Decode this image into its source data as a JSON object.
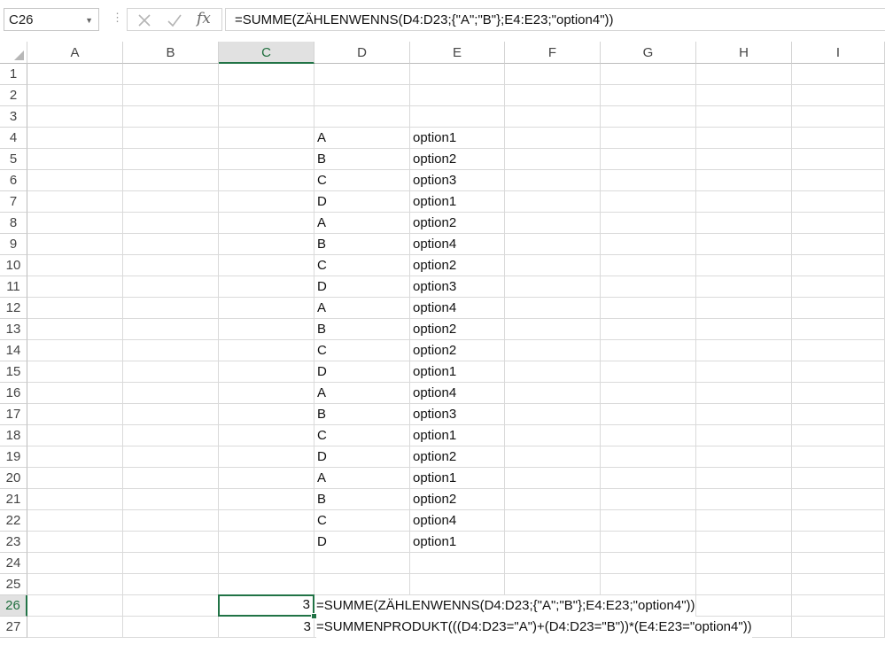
{
  "name_box": {
    "value": "C26"
  },
  "formula_bar": {
    "fx_label": "fx",
    "formula": "=SUMME(ZÄHLENWENNS(D4:D23;{\"A\";\"B\"};E4:E23;\"option4\"))"
  },
  "columns": [
    "A",
    "B",
    "C",
    "D",
    "E",
    "F",
    "G",
    "H",
    "I"
  ],
  "selected_column": "C",
  "rows": [
    "1",
    "2",
    "3",
    "4",
    "5",
    "6",
    "7",
    "8",
    "9",
    "10",
    "11",
    "12",
    "13",
    "14",
    "15",
    "16",
    "17",
    "18",
    "19",
    "20",
    "21",
    "22",
    "23",
    "24",
    "25",
    "26",
    "27"
  ],
  "selected_row": "26",
  "column_d": [
    "A",
    "B",
    "C",
    "D",
    "A",
    "B",
    "C",
    "D",
    "A",
    "B",
    "C",
    "D",
    "A",
    "B",
    "C",
    "D",
    "A",
    "B",
    "C",
    "D"
  ],
  "column_e": [
    "option1",
    "option2",
    "option3",
    "option1",
    "option2",
    "option4",
    "option2",
    "option3",
    "option4",
    "option2",
    "option2",
    "option1",
    "option4",
    "option3",
    "option1",
    "option2",
    "option1",
    "option2",
    "option4",
    "option1"
  ],
  "result_cells": [
    {
      "cell": "C26",
      "value": "3",
      "formula_text": "=SUMME(ZÄHLENWENNS(D4:D23;{\"A\";\"B\"};E4:E23;\"option4\"))"
    },
    {
      "cell": "C27",
      "value": "3",
      "formula_text": "=SUMMENPRODUKT(((D4:D23=\"A\")+(D4:D23=\"B\"))*(E4:E23=\"option4\"))"
    }
  ],
  "colors": {
    "accent_green": "#217346",
    "gridline": "#dadada"
  }
}
